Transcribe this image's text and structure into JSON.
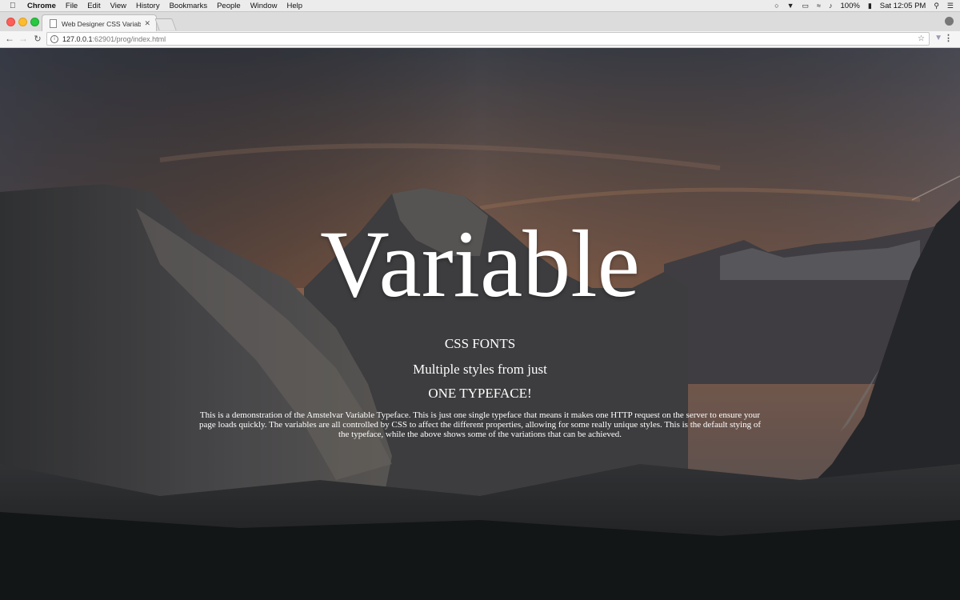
{
  "menubar": {
    "app_name": "Chrome",
    "menus": [
      "File",
      "Edit",
      "View",
      "History",
      "Bookmarks",
      "People",
      "Window",
      "Help"
    ],
    "battery": "100%",
    "clock": "Sat 12:05 PM"
  },
  "tab": {
    "title": "Web Designer CSS Variable Fo"
  },
  "address_bar": {
    "host": "127.0.0.1",
    "path": ":62901/prog/index.html"
  },
  "page": {
    "hero_title": "Variable",
    "line1": "CSS FONTS",
    "line2": "Multiple styles from just",
    "line3": "ONE TYPEFACE!",
    "paragraph": "This is a demonstration of the Amstelvar Variable Typeface. This is just one single typeface that means it makes one HTTP request on the server to ensure your page loads quickly. The variables are all controlled by CSS to affect the different properties, allowing for some really unique styles. This is the default stying of the typeface, while the above shows some of the variations that can be achieved."
  }
}
